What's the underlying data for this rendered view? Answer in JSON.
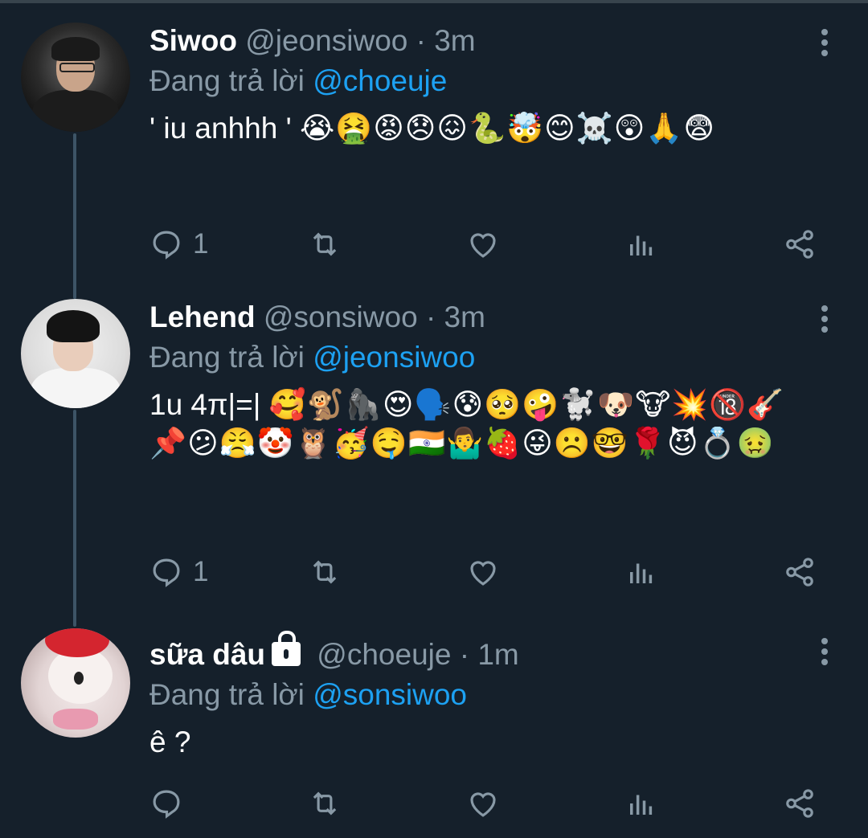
{
  "tweets": [
    {
      "name": "Siwoo",
      "handle": "@jeonsiwoo",
      "separator": "·",
      "time": "3m",
      "reply_prefix": "Đang trả lời",
      "reply_to": "@choeuje",
      "text": "' iu anhhh '",
      "emojis": "😭🤮😡😞😖🐍🤯😊☠️😲🙏😨",
      "reply_count": "1",
      "locked": false
    },
    {
      "name": "Lehend",
      "handle": "@sonsiwoo",
      "separator": "·",
      "time": "3m",
      "reply_prefix": "Đang trả lời",
      "reply_to": "@jeonsiwoo",
      "text": "1u 4π|=|",
      "emojis": "🥰🐒🦍😍🗣️😰🥺🤪🐩🐶🐮💥🔞🎸📌😕😤🤡🦉🥳🤤🇮🇳🤷‍♂️🍓😜☹️🤓🌹😈💍🤢",
      "reply_count": "1",
      "locked": false
    },
    {
      "name": "sữa dâu",
      "handle": "@choeuje",
      "separator": "·",
      "time": "1m",
      "reply_prefix": "Đang trả lời",
      "reply_to": "@sonsiwoo",
      "text": "ê ?",
      "emojis": "",
      "reply_count": "",
      "locked": true
    }
  ],
  "icons": [
    "reply-icon",
    "retweet-icon",
    "like-icon",
    "analytics-icon",
    "share-icon",
    "more-icon",
    "lock-icon"
  ],
  "colors": {
    "background": "#15202b",
    "secondary_text": "#8899a6",
    "link": "#1da1f2",
    "thread_line": "#3d5466"
  }
}
